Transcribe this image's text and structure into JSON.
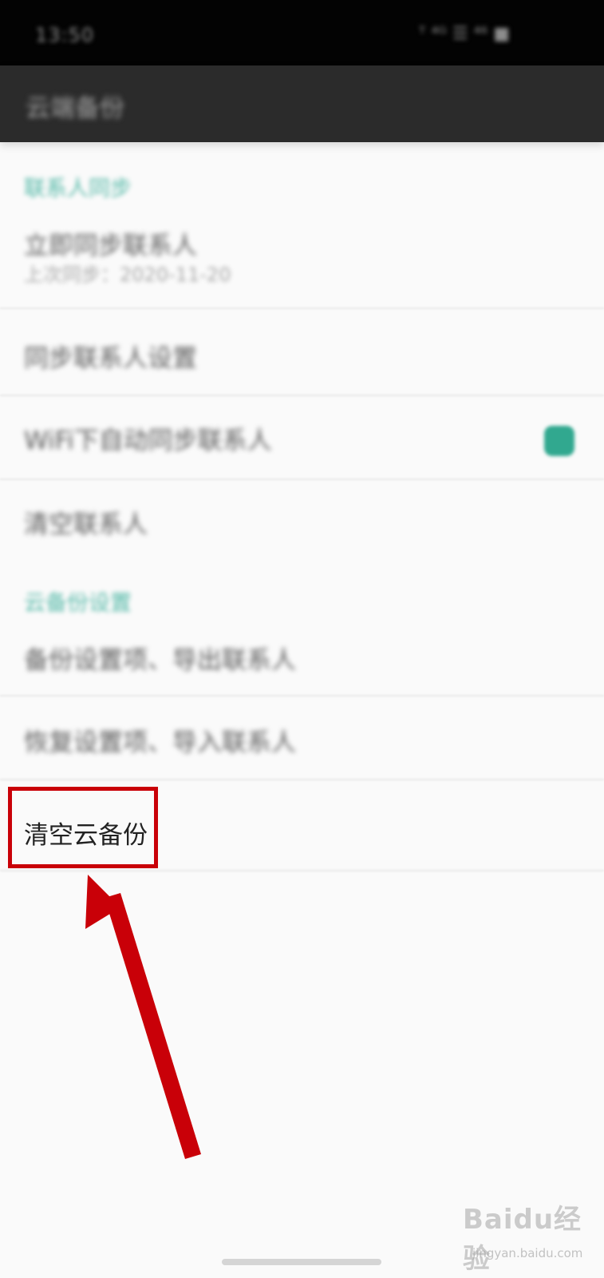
{
  "status_bar": {
    "time": "13:50",
    "icons": [
      "signal-icon",
      "wifi-icon",
      "battery-icon"
    ],
    "right_text": "ᵀ ⁴ᴳ ☰ ⁴⁶ ■"
  },
  "app_bar": {
    "title": "云端备份"
  },
  "sections": {
    "contacts_header": "联系人同步",
    "backup_header": "云备份设置"
  },
  "items": {
    "sync_contacts": {
      "label": "立即同步联系人",
      "subtitle": "上次同步：2020-11-20"
    },
    "contact_settings": {
      "label": "同步联系人设置"
    },
    "wifi_sync": {
      "label": "WiFi下自动同步联系人"
    },
    "clear_contacts": {
      "label": "清空联系人"
    },
    "backup_settings": {
      "label": "备份设置项、导出联系人"
    },
    "restore_settings": {
      "label": "恢复设置项、导入联系人"
    },
    "clear_backup": {
      "label": "清空云备份"
    }
  },
  "watermark": {
    "text": "Baidu经验",
    "subtext": "jingyan.baidu.com"
  },
  "colors": {
    "accent": "#31a88f",
    "highlight": "#c90008",
    "statusbar": "#030303",
    "appbar": "#2b2b2b",
    "background": "#fafafa"
  }
}
